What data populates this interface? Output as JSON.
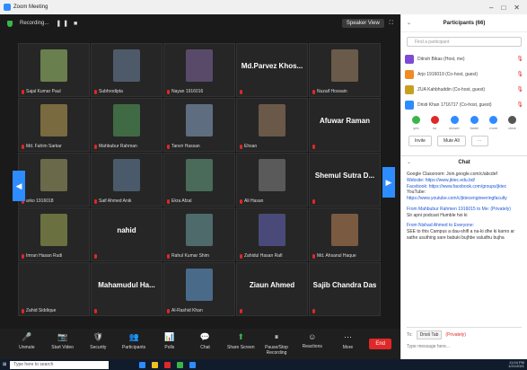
{
  "window": {
    "title": "Zoom Meeting"
  },
  "topbar": {
    "recording": "Recording...",
    "view_label": "Speaker View"
  },
  "tiles": [
    {
      "name": "Sajal Kumar Paul",
      "kind": "photo",
      "color": "#6a7f4e"
    },
    {
      "name": "Subhrodipta",
      "kind": "photo",
      "color": "#4e5a6a"
    },
    {
      "name": "Nayan 1916016",
      "kind": "photo",
      "color": "#5a4a6a"
    },
    {
      "name": "",
      "big": "Md.Parvez Khos...",
      "kind": "text"
    },
    {
      "name": "Nuzaif Hossain",
      "kind": "photo",
      "color": "#6a5a4a"
    },
    {
      "name": "Md. Fahim Sarkar",
      "kind": "photo",
      "color": "#7a6a40"
    },
    {
      "name": "Mahbubur Rahman",
      "kind": "photo",
      "color": "#3f6a44"
    },
    {
      "name": "Tanvir Hassan",
      "kind": "photo",
      "color": "#5e6e80"
    },
    {
      "name": "Ehsan",
      "kind": "photo",
      "color": "#6a5848"
    },
    {
      "name": "",
      "big": "Afuwar Raman",
      "kind": "text"
    },
    {
      "name": "arko 1916018",
      "kind": "photo",
      "color": "#6a6a4a"
    },
    {
      "name": "Saif Ahmed Anik",
      "kind": "photo",
      "color": "#4a5a6a"
    },
    {
      "name": "Ekra Afzal",
      "kind": "photo",
      "color": "#4a6a5a"
    },
    {
      "name": "Ali Hasan",
      "kind": "photo",
      "color": "#5a5a5a"
    },
    {
      "name": "",
      "big": "Shemul Sutra D...",
      "kind": "text"
    },
    {
      "name": "Imran Hasan Rudi",
      "kind": "photo",
      "color": "#6a7040"
    },
    {
      "name": "",
      "big": "nahid",
      "kind": "text"
    },
    {
      "name": "Rahul Kumar Shim",
      "kind": "photo",
      "color": "#4f6a6a"
    },
    {
      "name": "Zahidul Hasan Rafi",
      "kind": "photo",
      "color": "#4a4a7a"
    },
    {
      "name": "Md. Ahsanul Haque",
      "kind": "photo",
      "color": "#7a5a40"
    },
    {
      "name": "Zahid Siddique",
      "kind": "empty"
    },
    {
      "name": "",
      "big": "Mahamudul Ha...",
      "kind": "text"
    },
    {
      "name": "Al-Rashid Khan",
      "kind": "photo",
      "color": "#4a6a8a"
    },
    {
      "name": "",
      "big": "Ziaun Ahmed",
      "kind": "text"
    },
    {
      "name": "",
      "big": "Sajib Chandra Das",
      "kind": "text"
    }
  ],
  "toolbar": {
    "items": [
      {
        "label": "Unmute",
        "icon": "🎤"
      },
      {
        "label": "Start Video",
        "icon": "📷"
      },
      {
        "label": "Security",
        "icon": "🛡"
      },
      {
        "label": "Participants",
        "icon": "👥"
      },
      {
        "label": "Polls",
        "icon": "📊"
      },
      {
        "label": "Chat",
        "icon": "💬"
      },
      {
        "label": "Share Screen",
        "icon": "⬆"
      },
      {
        "label": "Pause/Stop Recording",
        "icon": "⏸"
      },
      {
        "label": "Reactions",
        "icon": "☺"
      },
      {
        "label": "More",
        "icon": "⋯"
      }
    ],
    "end_label": "End"
  },
  "participants": {
    "title": "Participants (66)",
    "search_placeholder": "Find a participant",
    "list": [
      {
        "name": "Ditnsh Bikas (Host, me)",
        "color": "#7c4bd6"
      },
      {
        "name": "Arjo 1916019 (Co-host, guest)",
        "color": "#f08a24"
      },
      {
        "name": "ZUA Kahbhuddin (Co-host, guest)",
        "color": "#c8a020"
      },
      {
        "name": "Dristi Khan 1716717 (Co-host, guest)",
        "color": "#2d8cff"
      }
    ],
    "reactions": [
      {
        "label": "yes",
        "color": "#3bb54a"
      },
      {
        "label": "no",
        "color": "#e02828"
      },
      {
        "label": "slower",
        "color": "#2d8cff"
      },
      {
        "label": "faster",
        "color": "#2d8cff"
      },
      {
        "label": "more",
        "color": "#2d8cff"
      },
      {
        "label": "clear",
        "color": "#555555"
      }
    ],
    "invite_label": "Invite",
    "mute_all_label": "Mute All"
  },
  "chat": {
    "title": "Chat",
    "messages": [
      {
        "text": "Google Classroom: Join.google.com/c/abcdef"
      },
      {
        "text": "Website: https://www.jktec.edu.bd/",
        "link": true
      },
      {
        "text": "Facebook: https://www.facebook.com/groups/jktec",
        "link": true
      },
      {
        "text": "YouTube:"
      },
      {
        "text": "https://www.youtube.com/c/jktecengineeringfaculty",
        "link": true
      },
      {
        "from": "From Mahbubur Rahmen 1916015 to Me: (Privately)",
        "text": "Sir apni podcast Humble hoi ki"
      },
      {
        "from": "From Nishad Ahmed to Everyone:",
        "text": "SEE to this Campus a dau-shifl a na-ki dhe ki karno ar sathe usuthing sare babuki bujhbe valudhu bujha"
      }
    ],
    "to_label": "To:",
    "to_value": "Dristi Tab",
    "privately_label": "(Privately)",
    "input_placeholder": "Type message here..."
  },
  "taskbar": {
    "search_placeholder": "Type here to search",
    "time": "11:04 PM",
    "date": "1/21/2021"
  }
}
